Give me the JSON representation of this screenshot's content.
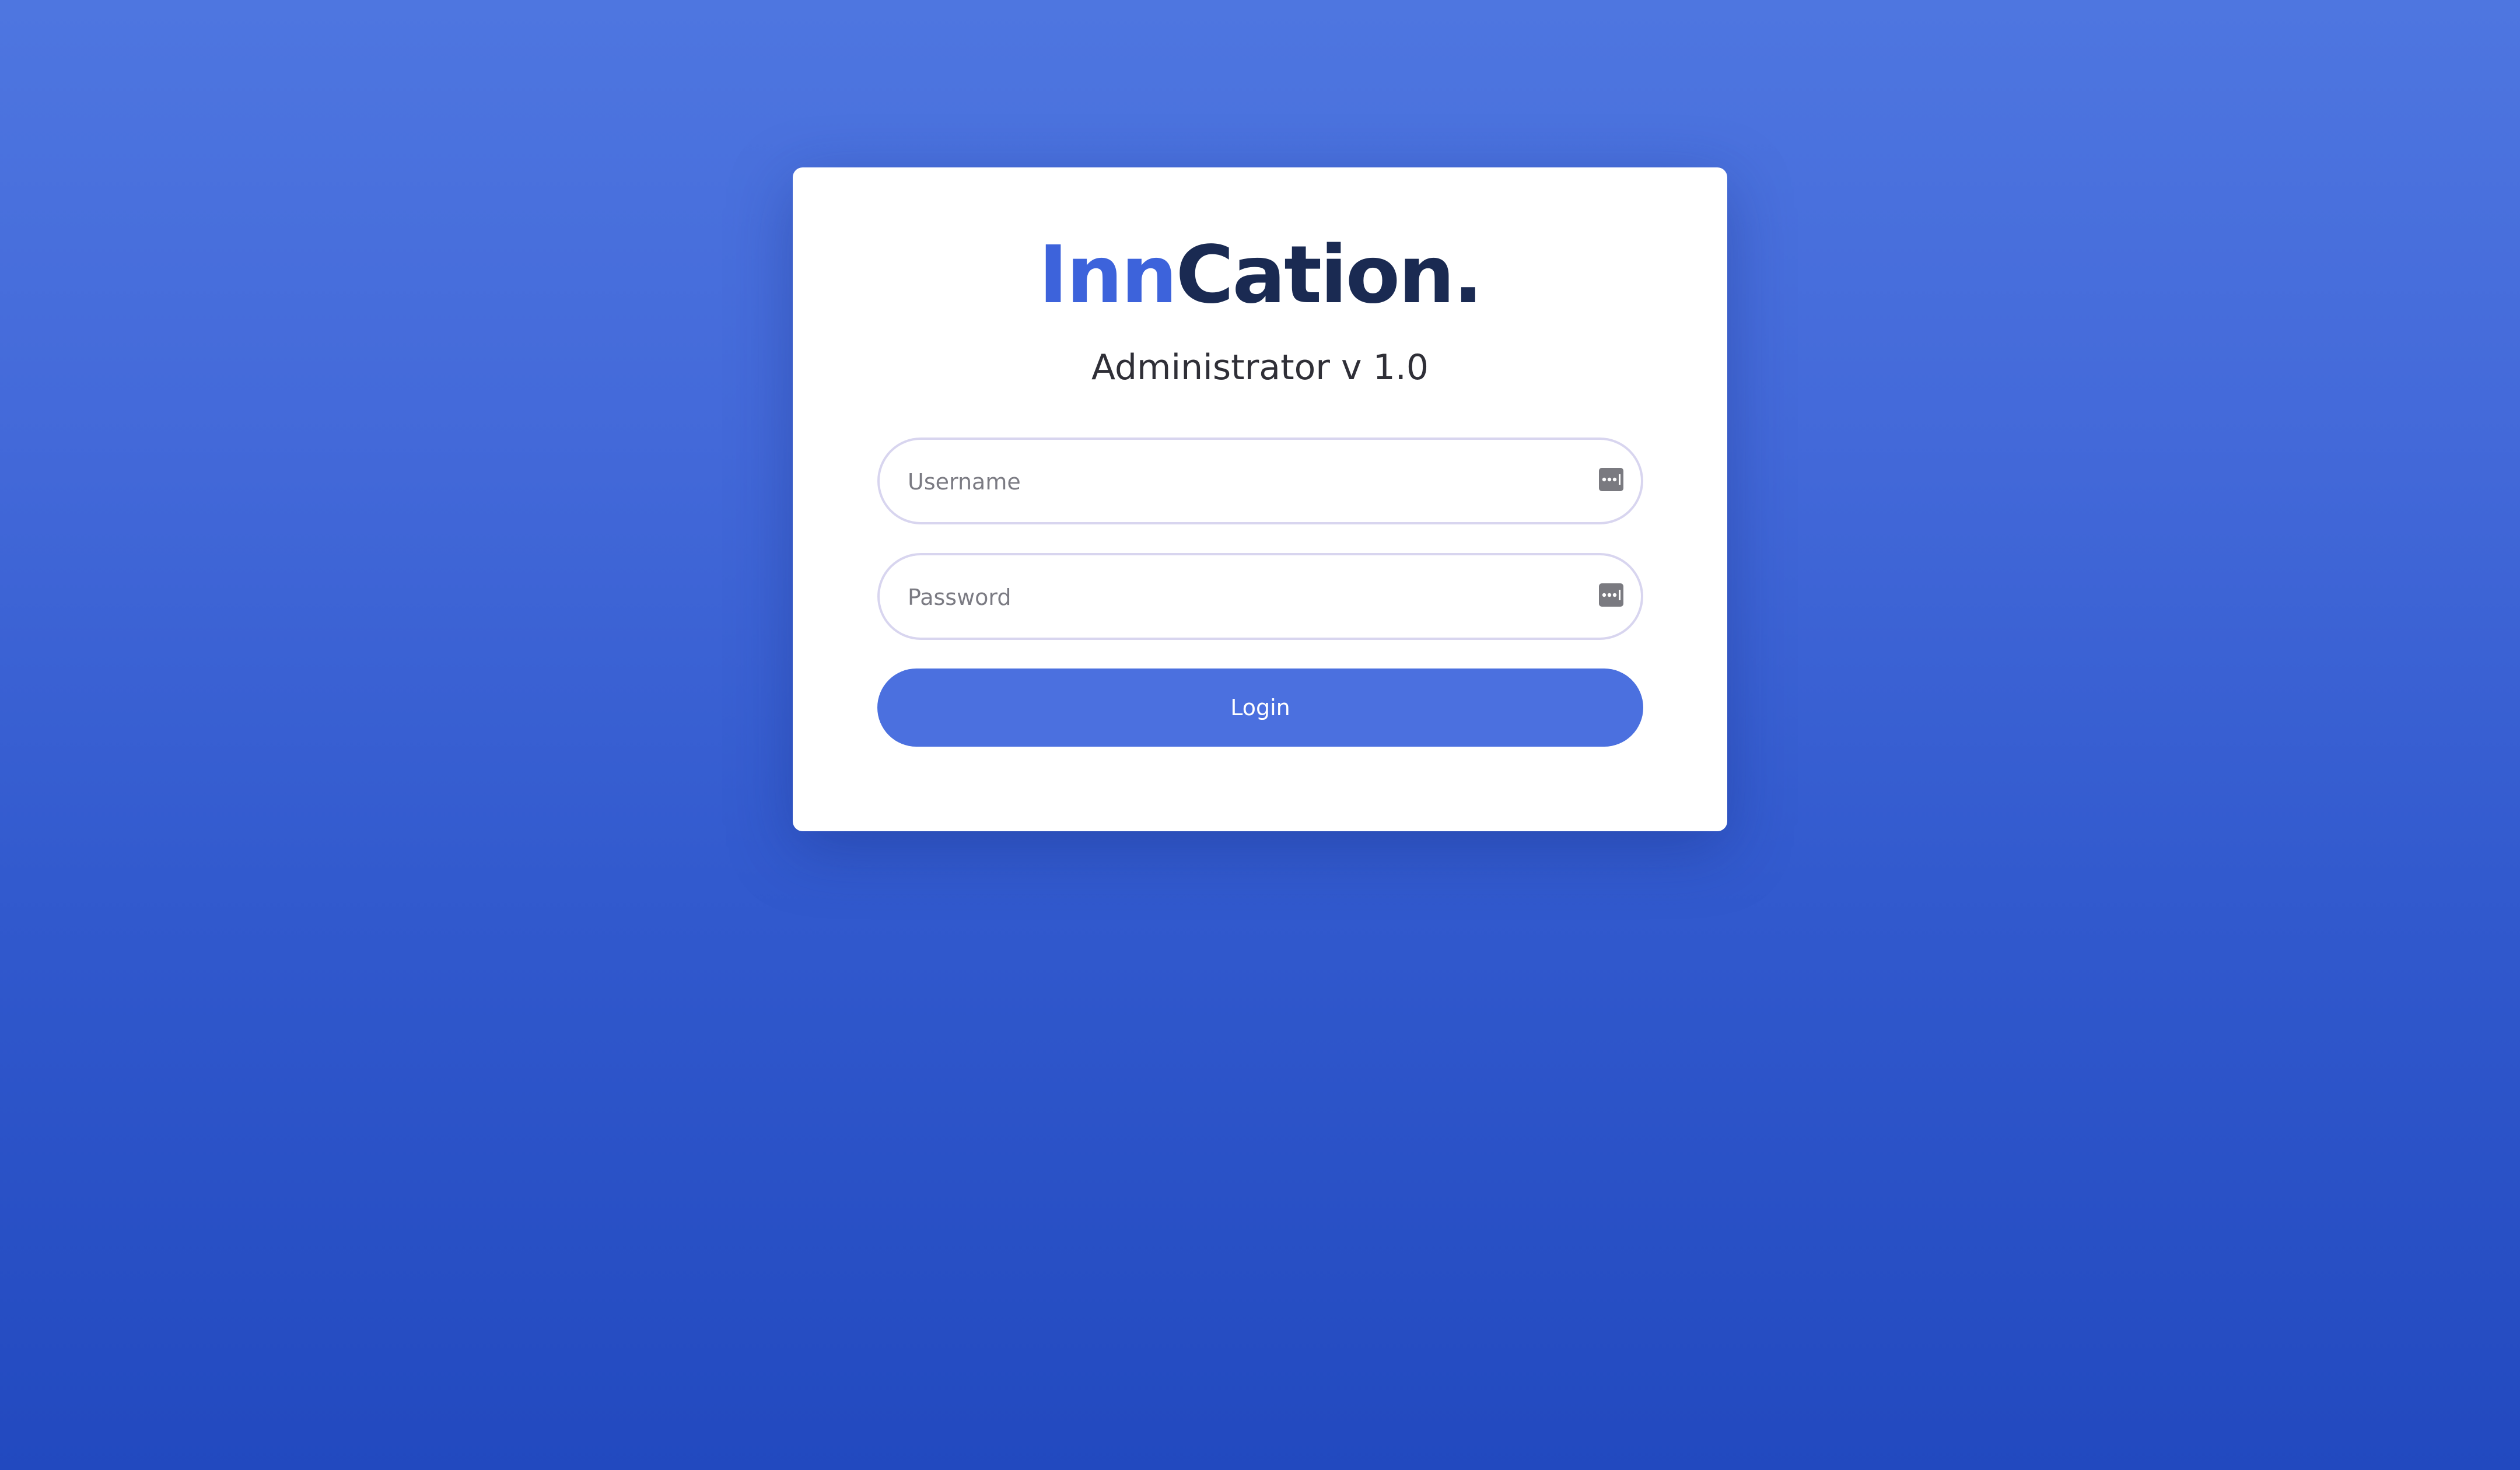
{
  "brand": {
    "logo_part1": "Inn",
    "logo_part2": "Cation.",
    "colors": {
      "accent": "#3d63db",
      "dark": "#1a2a52"
    }
  },
  "subtitle": "Administrator v 1.0",
  "form": {
    "username": {
      "placeholder": "Username",
      "value": "",
      "icon": "password-manager-icon"
    },
    "password": {
      "placeholder": "Password",
      "value": "",
      "icon": "password-manager-icon"
    },
    "login_label": "Login"
  },
  "colors": {
    "background_top": "#4e76e0",
    "background_bottom": "#2249bf",
    "button": "#4b70df",
    "field_border": "#d8d5ef"
  }
}
